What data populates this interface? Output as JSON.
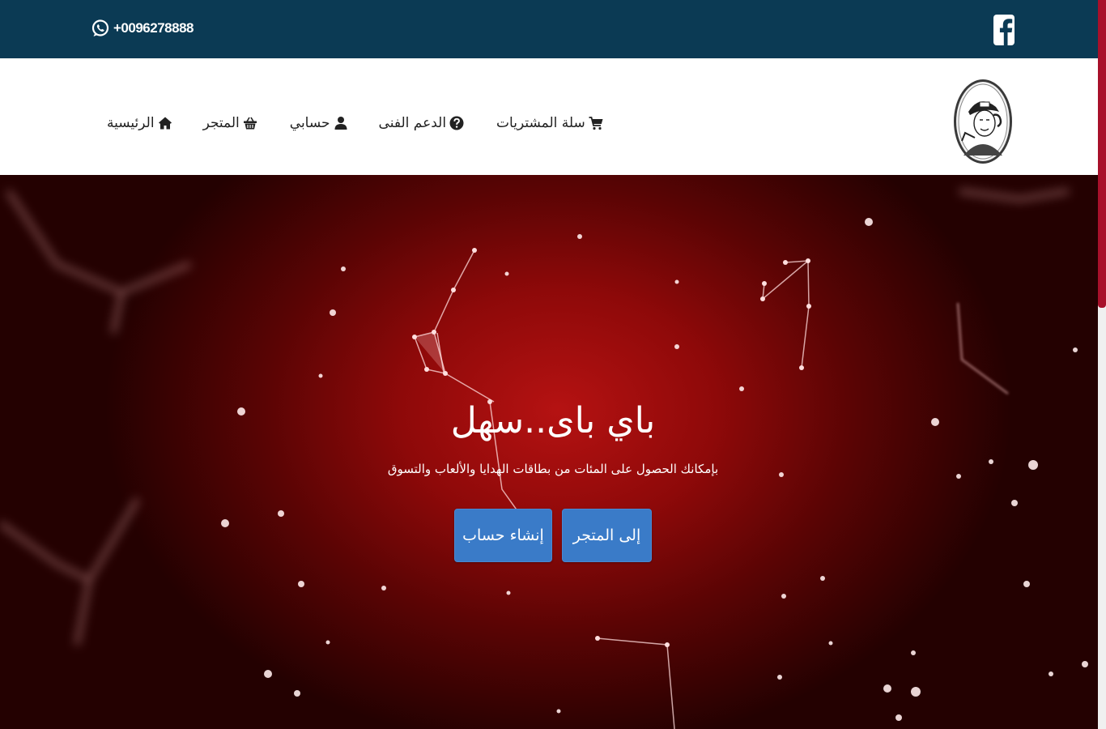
{
  "topbar": {
    "phone": "+0096278888",
    "whatsapp_icon": "whatsapp-icon",
    "facebook_icon": "facebook-icon"
  },
  "nav": {
    "items": [
      {
        "label": "الرئيسية",
        "icon": "home-icon"
      },
      {
        "label": "المتجر",
        "icon": "basket-icon"
      },
      {
        "label": "حسابي",
        "icon": "user-icon"
      },
      {
        "label": "الدعم الفنى",
        "icon": "question-icon"
      },
      {
        "label": "سلة المشتريات",
        "icon": "cart-icon"
      }
    ]
  },
  "hero": {
    "title": "باي باى..سهل",
    "subtitle": "بإمكانك الحصول على المئات من بطاقات الهدايا والألعاب والتسوق",
    "store_button": "إلى المتجر",
    "signup_button": "إنشاء حساب"
  },
  "colors": {
    "topbar": "#0b3a54",
    "button": "#3a7bc8",
    "hero_center": "#b51212",
    "scrollbar": "#a8102a"
  }
}
